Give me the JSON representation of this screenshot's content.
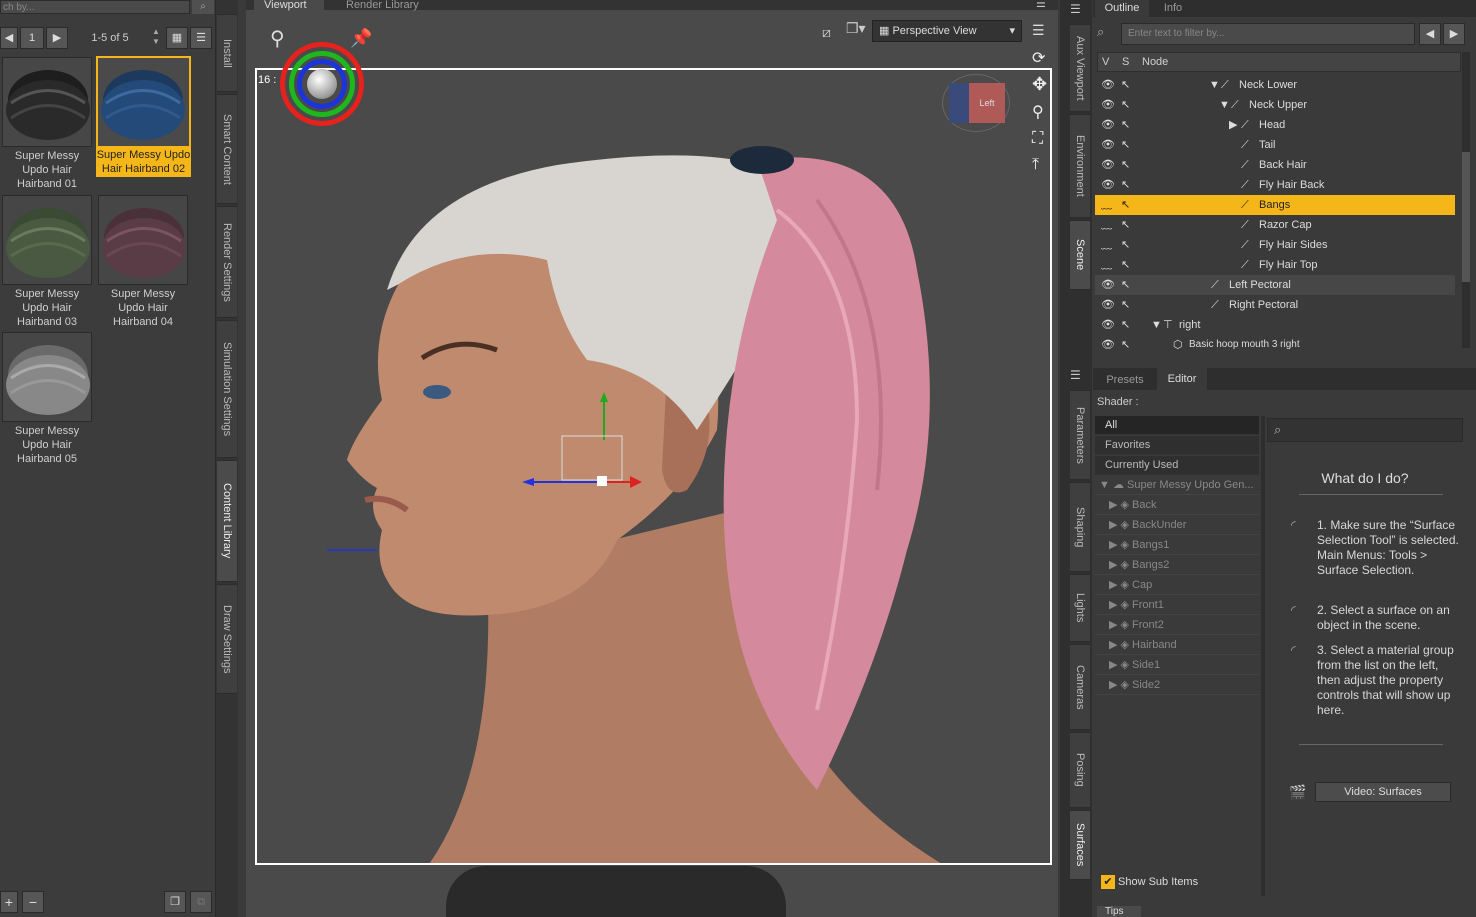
{
  "library": {
    "search_placeholder": "ch by...",
    "page": "1",
    "range": "1-5 of 5",
    "items": [
      {
        "label": "Super Messy Updo Hair Hairband 01"
      },
      {
        "label": "Super Messy Updo Hair Hairband 02"
      },
      {
        "label": "Super Messy Updo Hair Hairband 03"
      },
      {
        "label": "Super Messy Updo Hair Hairband 04"
      },
      {
        "label": "Super Messy Updo Hair Hairband 05"
      }
    ]
  },
  "left_vtabs": [
    "Install",
    "Smart Content",
    "Render Settings",
    "Simulation Settings",
    "Content Library",
    "Draw Settings"
  ],
  "viewport": {
    "tabs": [
      "Viewport",
      "Render Library"
    ],
    "view_mode": "Perspective View",
    "aspect_label": "16 :",
    "cube_label": "Left"
  },
  "right_vtabs_top": [
    "Aux Viewport",
    "Environment",
    "Scene"
  ],
  "right_vtabs_bottom": [
    "Parameters",
    "Shaping",
    "Lights",
    "Cameras",
    "Posing",
    "Surfaces"
  ],
  "outline": {
    "tabs": [
      "Outline",
      "Info"
    ],
    "filter_placeholder": "Enter text to filter by...",
    "headers": {
      "v": "V",
      "s": "S",
      "node": "Node"
    },
    "nodes": [
      {
        "name": "Neck Lower"
      },
      {
        "name": "Neck Upper"
      },
      {
        "name": "Head"
      },
      {
        "name": "Tail"
      },
      {
        "name": "Back Hair"
      },
      {
        "name": "Fly Hair Back"
      },
      {
        "name": "Bangs"
      },
      {
        "name": "Razor Cap"
      },
      {
        "name": "Fly Hair Sides"
      },
      {
        "name": "Fly Hair Top"
      },
      {
        "name": "Left Pectoral"
      },
      {
        "name": "Right Pectoral"
      },
      {
        "name": "right"
      },
      {
        "name": "Basic hoop mouth 3 right"
      }
    ]
  },
  "editor": {
    "tabs": [
      "Presets",
      "Editor"
    ],
    "shader_label": "Shader :",
    "filters": [
      "All",
      "Favorites",
      "Currently Used"
    ],
    "group": "Super Messy Updo Gen...",
    "surfaces": [
      "Back",
      "BackUnder",
      "Bangs1",
      "Bangs2",
      "Cap",
      "Front1",
      "Front2",
      "Hairband",
      "Side1",
      "Side2"
    ],
    "show_sub_items": "Show Sub Items",
    "help_title": "What do I do?",
    "help_steps": [
      "1. Make sure the “Surface Selection Tool” is selected. Main Menus: Tools > Surface Selection.",
      "2. Select a surface on an object in the scene.",
      "3. Select a material group from the list on the left, then adjust the property controls that will show up here."
    ],
    "video_button": "Video: Surfaces"
  },
  "tips_tab": "Tips",
  "colors": {
    "accent": "#f5b619",
    "panel": "#3a3a3a",
    "viewport_bg": "#4a4a4a"
  }
}
